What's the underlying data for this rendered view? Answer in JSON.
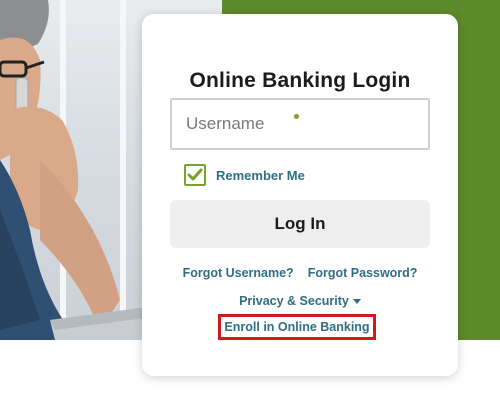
{
  "login": {
    "title": "Online Banking Login",
    "username_placeholder": "Username",
    "remember_me": "Remember Me",
    "remember_checked": true,
    "login_button": "Log In",
    "forgot_username": "Forgot Username?",
    "forgot_password": "Forgot Password?",
    "privacy_security": "Privacy & Security",
    "enroll": "Enroll in Online Banking"
  },
  "colors": {
    "brand_green": "#5d8a2a",
    "accent_green": "#78a22f",
    "link_teal": "#2f6f86",
    "highlight_red": "#d11a1a"
  },
  "icons": [
    "checkmark-icon",
    "caret-down-icon",
    "required-dot-icon"
  ]
}
